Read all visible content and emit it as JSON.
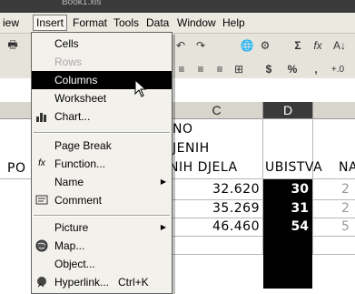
{
  "window": {
    "title": "Book1.xls"
  },
  "menubar": {
    "items": [
      {
        "label": "iew"
      },
      {
        "label": "Insert"
      },
      {
        "label": "Format"
      },
      {
        "label": "Tools"
      },
      {
        "label": "Data"
      },
      {
        "label": "Window"
      },
      {
        "label": "Help"
      }
    ]
  },
  "toolbar": {
    "sigma": "Σ",
    "fx": "fx",
    "sort": "A↓",
    "currency": "$",
    "percent": "%",
    "comma": ",",
    "decimals": "+.0"
  },
  "insert_menu": {
    "items": [
      {
        "label": "Cells",
        "icon": ""
      },
      {
        "label": "Rows",
        "icon": ""
      },
      {
        "label": "Columns",
        "icon": ""
      },
      {
        "label": "Worksheet",
        "icon": ""
      },
      {
        "label": "Chart...",
        "icon": "chart-icon"
      },
      {
        "label": "Page Break",
        "icon": ""
      },
      {
        "label": "Function...",
        "icon": "fx"
      },
      {
        "label": "Name",
        "icon": ""
      },
      {
        "label": "Comment",
        "icon": "comment-icon"
      },
      {
        "label": "Picture",
        "icon": ""
      },
      {
        "label": "Map...",
        "icon": "globe-icon"
      },
      {
        "label": "Object...",
        "icon": ""
      },
      {
        "label": "Hyperlink...",
        "shortcut": "Ctrl+K",
        "icon": "hyperlink-icon"
      }
    ]
  },
  "sheet": {
    "col_c": "C",
    "col_d": "D",
    "header_c_lines": [
      "NO",
      "JENIH",
      "NIH DJELA"
    ],
    "header_d": "UBISTVA",
    "header_e": "NA",
    "header_left": "PO",
    "c_values": [
      "32.620",
      "35.269",
      "46.460"
    ],
    "d_values": [
      "30",
      "31",
      "54"
    ],
    "e_values": [
      "2",
      "2",
      "5"
    ]
  }
}
